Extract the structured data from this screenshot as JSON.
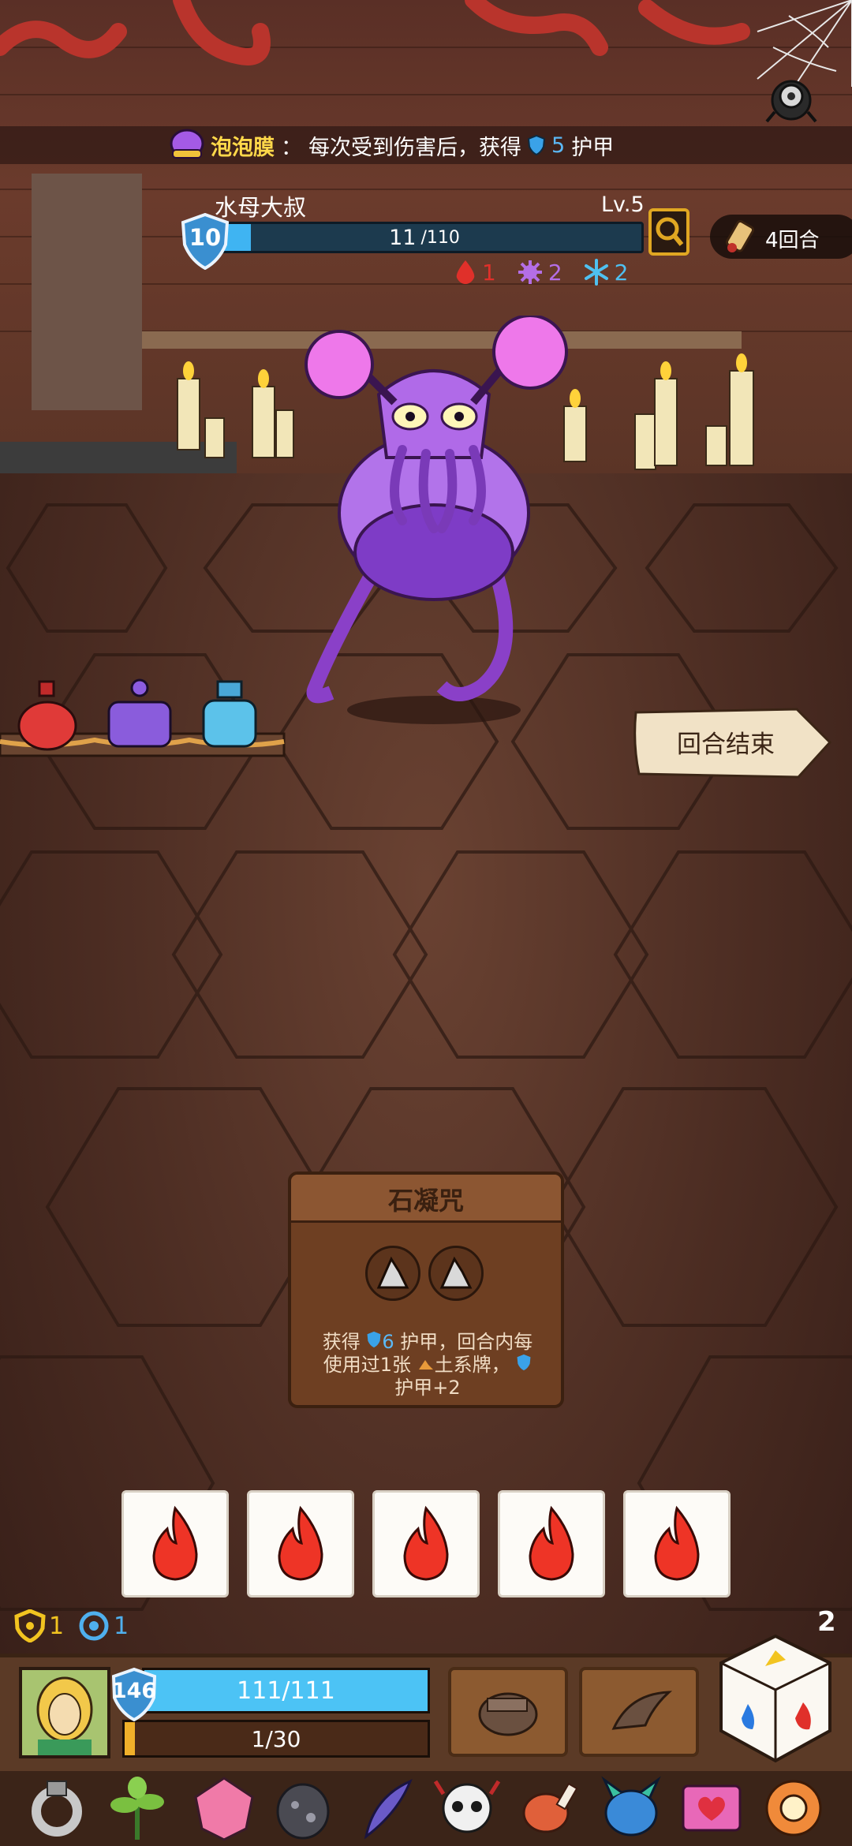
{
  "battle": {
    "passive": {
      "name": "泡泡膜",
      "separator": "：",
      "text_before": "每次受到伤害后，获得",
      "amount": "5",
      "text_after": "护甲"
    },
    "enemy": {
      "name": "水母大叔",
      "level": "Lv.5",
      "armor": "10",
      "hp_current": "11",
      "hp_max": "/110",
      "hp_fraction": 0.1,
      "statuses": [
        {
          "icon": "blood-drop-icon",
          "value": "1",
          "color": "#e0302a"
        },
        {
          "icon": "poison-splat-icon",
          "value": "2",
          "color": "#b46ee6"
        },
        {
          "icon": "snowflake-icon",
          "value": "2",
          "color": "#4fc0f0"
        }
      ]
    },
    "turn_counter": "4回合",
    "end_turn_label": "回合结束"
  },
  "card": {
    "title": "石凝咒",
    "rune_icons": [
      "earth-rune-icon",
      "earth-rune-icon"
    ],
    "desc": {
      "p1": "获得",
      "armor_amount": "6",
      "p2": "护甲，回合内每",
      "p3": "使用过1张",
      "p4": "土系牌，",
      "p5": "护甲+2"
    }
  },
  "dice": [
    "fire-icon",
    "fire-icon",
    "fire-icon",
    "fire-icon",
    "fire-icon"
  ],
  "player": {
    "counters": [
      {
        "icon": "gold-shield-icon",
        "value": "1",
        "color": "#f2c420"
      },
      {
        "icon": "blue-ring-icon",
        "value": "1",
        "color": "#4fb0ee"
      }
    ],
    "deck_count": "2",
    "armor": "146",
    "hp": "111/111",
    "hp_fraction": 1.0,
    "xp": "1/30",
    "xp_fraction": 0.033,
    "abilities": [
      "fist-ability-icon",
      "claw-ability-icon"
    ]
  },
  "items": [
    "ring-icon",
    "herb-icon",
    "crystal-icon",
    "stone-egg-icon",
    "feather-icon",
    "skull-icon",
    "meat-icon",
    "dragon-icon",
    "heart-scroll-icon",
    "donut-icon"
  ],
  "colors": {
    "accent_gold": "#ffd84a",
    "hp_blue": "#3fb4f2",
    "xp_orange": "#f0b02a"
  }
}
